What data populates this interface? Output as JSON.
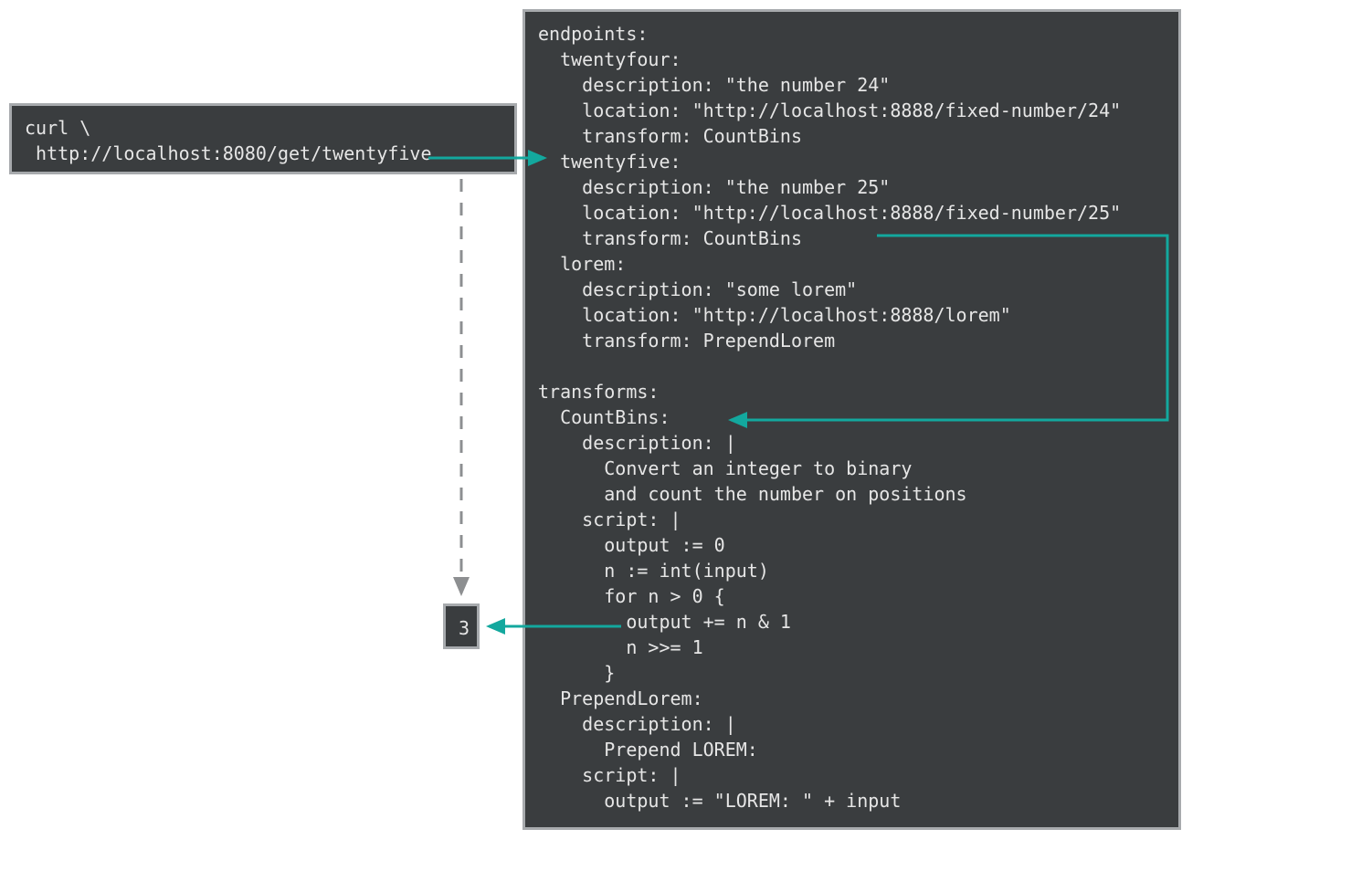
{
  "colors": {
    "box_bg": "#3a3d3f",
    "box_border": "#a7aaad",
    "text": "#e6e6e6",
    "arrow_teal": "#13a89e",
    "arrow_gray": "#8d8f91"
  },
  "left_box": {
    "text": "curl \\\n http://localhost:8080/get/twentyfive"
  },
  "result_box": {
    "text": "3"
  },
  "config_box": {
    "text": "endpoints:\n  twentyfour:\n    description: \"the number 24\"\n    location: \"http://localhost:8888/fixed-number/24\"\n    transform: CountBins\n  twentyfive:\n    description: \"the number 25\"\n    location: \"http://localhost:8888/fixed-number/25\"\n    transform: CountBins\n  lorem:\n    description: \"some lorem\"\n    location: \"http://localhost:8888/lorem\"\n    transform: PrependLorem\n\ntransforms:\n  CountBins:\n    description: |\n      Convert an integer to binary\n      and count the number on positions\n    script: |\n      output := 0\n      n := int(input)\n      for n > 0 {\n        output += n & 1\n        n >>= 1\n      }\n  PrependLorem:\n    description: |\n      Prepend LOREM:\n    script: |\n      output := \"LOREM: \" + input"
  }
}
